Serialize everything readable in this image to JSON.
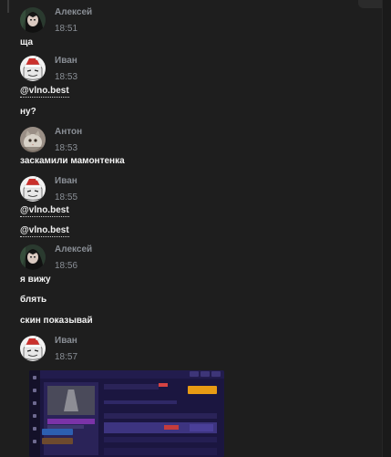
{
  "messages": [
    {
      "author": "Алексей",
      "time": "18:51",
      "avatar": "anime-girl-avatar",
      "lines": [
        "ща"
      ]
    },
    {
      "author": "Иван",
      "time": "18:53",
      "avatar": "santa-hat-avatar",
      "lines": [
        "@vlno.best",
        "ну?"
      ]
    },
    {
      "author": "Антон",
      "time": "18:53",
      "avatar": "cat-photo-avatar",
      "lines": [
        "заскамили мамонтенка"
      ]
    },
    {
      "author": "Иван",
      "time": "18:55",
      "avatar": "santa-hat-avatar",
      "lines": [
        "@vlno.best",
        "@vlno.best"
      ]
    },
    {
      "author": "Алексей",
      "time": "18:56",
      "avatar": "anime-girl-avatar",
      "lines": [
        "я вижу",
        "блять",
        "скин показывай"
      ]
    },
    {
      "author": "Иван",
      "time": "18:57",
      "avatar": "santa-hat-avatar",
      "lines": []
    }
  ],
  "attachment": {
    "icon": "screenshot-image",
    "colors": {
      "bg": "#1b1640",
      "accent_orange": "#e89b14",
      "accent_purple": "#7b33a8"
    }
  },
  "colors": {
    "background": "#1e1e1e",
    "meta": "#8a8f96",
    "text": "#f2f2f2"
  }
}
